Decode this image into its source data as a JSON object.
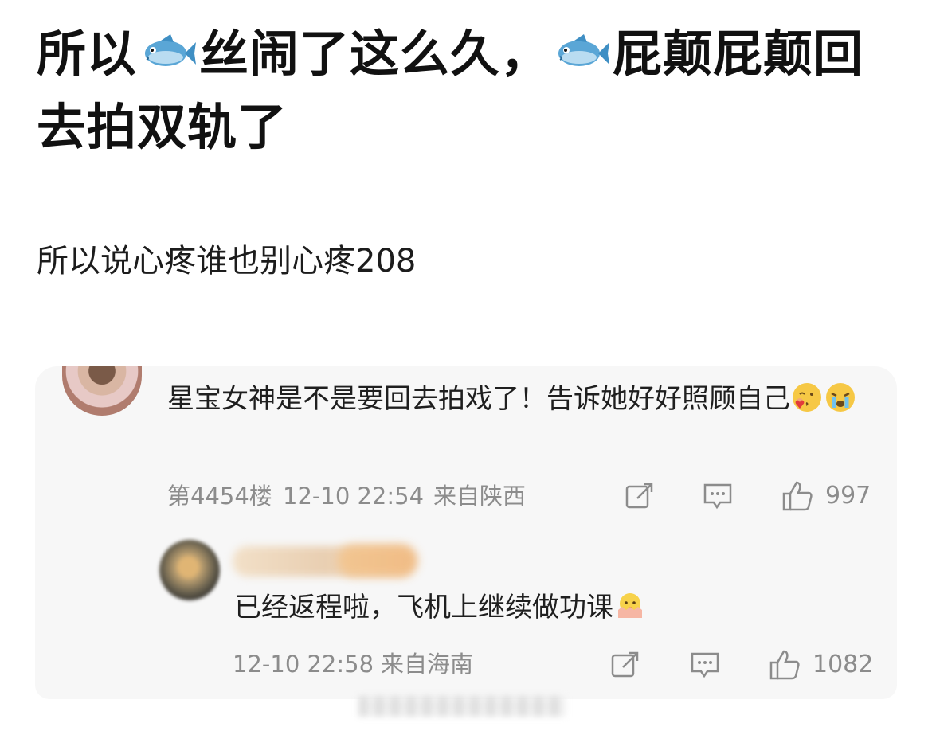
{
  "post": {
    "title_part1": "所以",
    "title_part2": "丝闹了这么久，",
    "title_part3": "屁颠屁颠回去拍双轨了",
    "fish_icon": "fish-emoji",
    "subtitle": "所以说心疼谁也别心疼208"
  },
  "comment": {
    "text": "星宝女神是不是要回去拍戏了！告诉她好好照顾自己",
    "emojis": [
      "kiss-heart-emoji",
      "crying-emoji"
    ],
    "floor": "第4454楼",
    "time": "12-10 22:54",
    "location": "来自陕西",
    "likes": "997"
  },
  "reply": {
    "text": "已经返程啦，飞机上继续做功课",
    "emoji": "hatching-chick-emoji",
    "time": "12-10 22:58",
    "location": "来自海南",
    "likes": "1082"
  }
}
